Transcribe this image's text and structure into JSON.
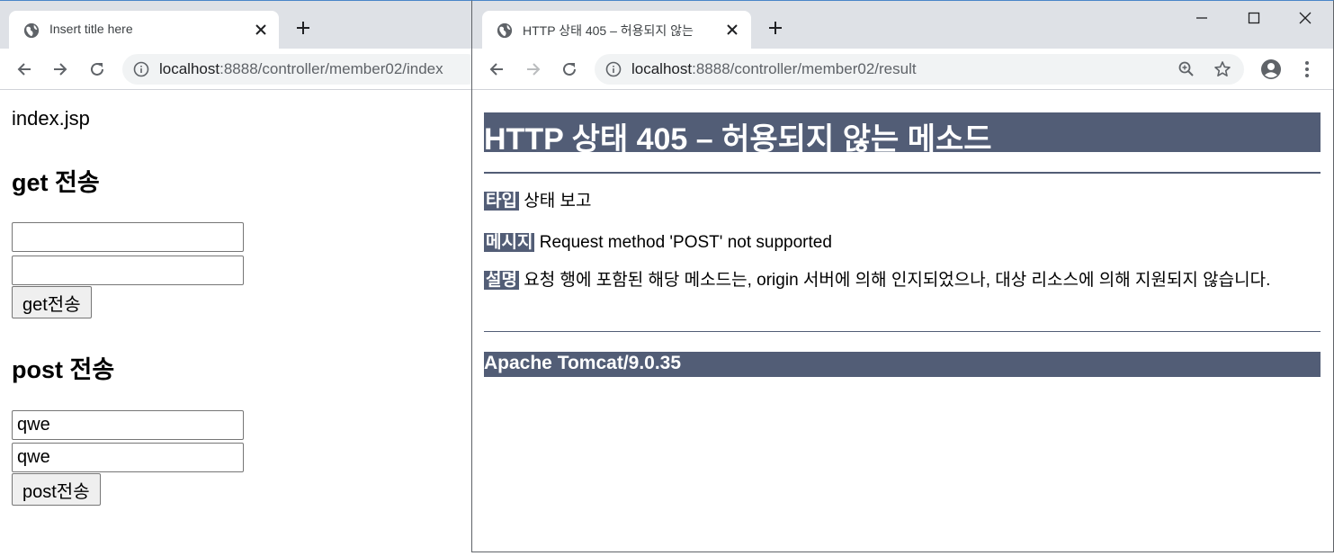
{
  "left_window": {
    "tab": {
      "title": "Insert title here",
      "icon": "globe-icon"
    },
    "toolbar": {
      "url_host": "localhost",
      "url_rest": ":8888/controller/member02/index"
    },
    "page": {
      "file_name": "index.jsp",
      "get_section": {
        "heading": "get 전송",
        "field1_value": "",
        "field2_value": "",
        "button_label": "get전송"
      },
      "post_section": {
        "heading": "post 전송",
        "field1_value": "qwe",
        "field2_value": "qwe",
        "button_label": "post전송"
      }
    }
  },
  "right_window": {
    "tab": {
      "title": "HTTP 상태 405 – 허용되지 않는",
      "icon": "globe-icon"
    },
    "toolbar": {
      "url_host": "localhost",
      "url_rest": ":8888/controller/member02/result"
    },
    "page": {
      "heading": "HTTP 상태 405 – 허용되지 않는 메소드",
      "type_label": "타입",
      "type_value": "상태 보고",
      "message_label": "메시지",
      "message_value": "Request method 'POST' not supported",
      "description_label": "설명",
      "description_value": "요청 행에 포함된 해당 메소드는, origin 서버에 의해 인지되었으나, 대상 리소스에 의해 지원되지 않습니다.",
      "footer": "Apache Tomcat/9.0.35"
    }
  },
  "colors": {
    "tomcat_accent": "#525d76",
    "tabstrip_bg": "#dee1e6",
    "omnibox_bg": "#f1f3f4"
  }
}
